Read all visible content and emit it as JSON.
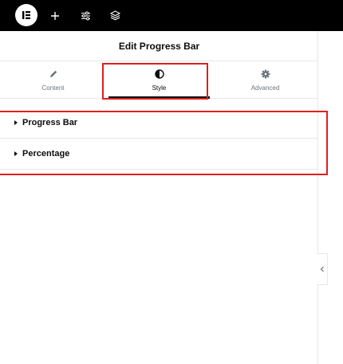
{
  "topbar": {
    "icons": [
      "elementor-logo-icon",
      "plus-icon",
      "sliders-icon",
      "layers-icon"
    ]
  },
  "panel": {
    "title": "Edit Progress Bar",
    "tabs": [
      {
        "label": "Content",
        "icon": "pencil-icon",
        "active": false
      },
      {
        "label": "Style",
        "icon": "half-circle-icon",
        "active": true
      },
      {
        "label": "Advanced",
        "icon": "gear-icon",
        "active": false
      }
    ],
    "sections": [
      {
        "label": "Progress Bar",
        "icon": "caret-right-icon"
      },
      {
        "label": "Percentage",
        "icon": "caret-right-icon"
      }
    ]
  },
  "colors": {
    "topbar": "#000000",
    "text": "#0c0d0e",
    "muted": "#69727d",
    "border": "#e6e8ea",
    "highlight": "#e01e1e"
  }
}
